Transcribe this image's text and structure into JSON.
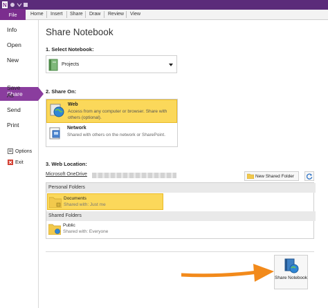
{
  "ribbon": {
    "file_tab": "File",
    "tabs": [
      "Home",
      "Insert",
      "Share",
      "Draw",
      "Review",
      "View"
    ]
  },
  "sidebar": {
    "items": [
      "Info",
      "Open",
      "New",
      "Share",
      "Save As",
      "Send",
      "Print"
    ],
    "options": "Options",
    "exit": "Exit"
  },
  "main": {
    "title": "Share Notebook",
    "section1": "1. Select Notebook:",
    "notebook_value": "Projects",
    "section2": "2. Share On:",
    "web_title": "Web",
    "web_desc": "Access from any computer or browser. Share with others (optional).",
    "network_title": "Network",
    "network_desc": "Shared with others on the network or SharePoint.",
    "section3": "3. Web Location:",
    "onedrive_label": "Microsoft OneDrive",
    "new_folder_label": "New Shared Folder",
    "personal_folders": "Personal Folders",
    "documents_name": "Documents",
    "documents_shared": "Shared with: Just me",
    "shared_folders": "Shared Folders",
    "public_name": "Public",
    "public_shared": "Shared with: Everyone",
    "share_button": "Share Notebook"
  },
  "colors": {
    "accent_purple": "#7b2d8e",
    "highlight_yellow": "#fbd85a",
    "arrow_orange": "#f28a1b"
  }
}
